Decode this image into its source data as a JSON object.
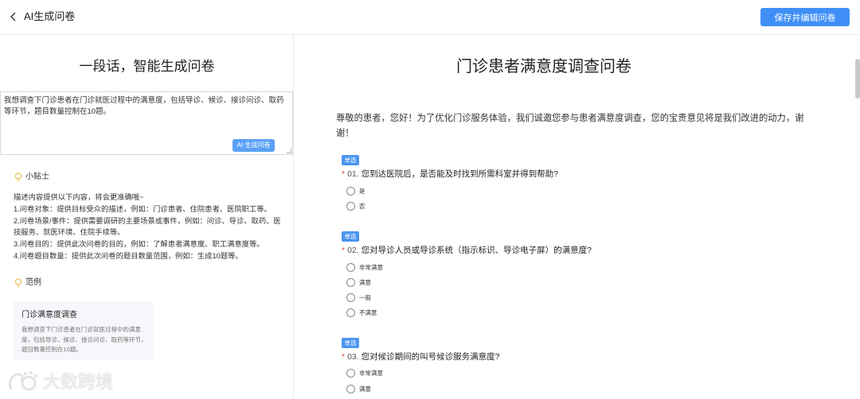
{
  "header": {
    "back_icon": "chevron-left-icon",
    "title": "AI生成问卷",
    "save_label": "保存并编辑问卷",
    "accent_color": "#3f8ff7"
  },
  "left": {
    "title": "一段话，智能生成问卷",
    "prompt_text": "我想调查下门诊患者在门诊就医过程中的满意度，包括导诊、候诊、接诊问诊、取药等环节，题目数量控制在10题。",
    "generate_label": "AI 生成问卷",
    "tips_label": "小贴士",
    "tips_lines": [
      "描述内容提供以下内容，将会更准确哦~",
      "1.问卷对象：提供目标受众的描述，例如：门诊患者、住院患者、医院职工等。",
      "2.问卷场景/事件：提供需要调研的主要场景或事件，例如：问诊、导诊、取药、医技服务、就医环境、住院手续等。",
      "3.问卷目的：提供此次问卷的目的，例如：了解患者满意度、职工满意度等。",
      "4.问卷题目数量：提供此次问卷的题目数量范围，例如：生成10题等。"
    ],
    "example_label": "范例",
    "example_title": "门诊满意度调查",
    "example_desc": "我想调查下门诊患者在门诊就医过程中的满意度，包括导诊、候诊、接诊问诊、取药等环节，题目数量控制在10题。",
    "watermark": "大数跨境"
  },
  "survey": {
    "title": "门诊患者满意度调查问卷",
    "intro": "尊敬的患者，您好！为了优化门诊服务体验，我们诚邀您参与患者满意度调查，您的宝贵意见将是我们改进的动力，谢谢！",
    "questions": [
      {
        "tag": "单选",
        "required": "*",
        "num": "01.",
        "text": "您到达医院后，是否能及时找到所需科室并得到帮助?",
        "options": [
          "是",
          "否"
        ]
      },
      {
        "tag": "单选",
        "required": "*",
        "num": "02.",
        "text": "您对导诊人员或导诊系统（指示标识、导诊电子屏）的满意度?",
        "options": [
          "非常满意",
          "满意",
          "一般",
          "不满意"
        ]
      },
      {
        "tag": "单选",
        "required": "*",
        "num": "03.",
        "text": "您对候诊期间的叫号候诊服务满意度?",
        "options": [
          "非常满意",
          "满意"
        ]
      }
    ]
  }
}
